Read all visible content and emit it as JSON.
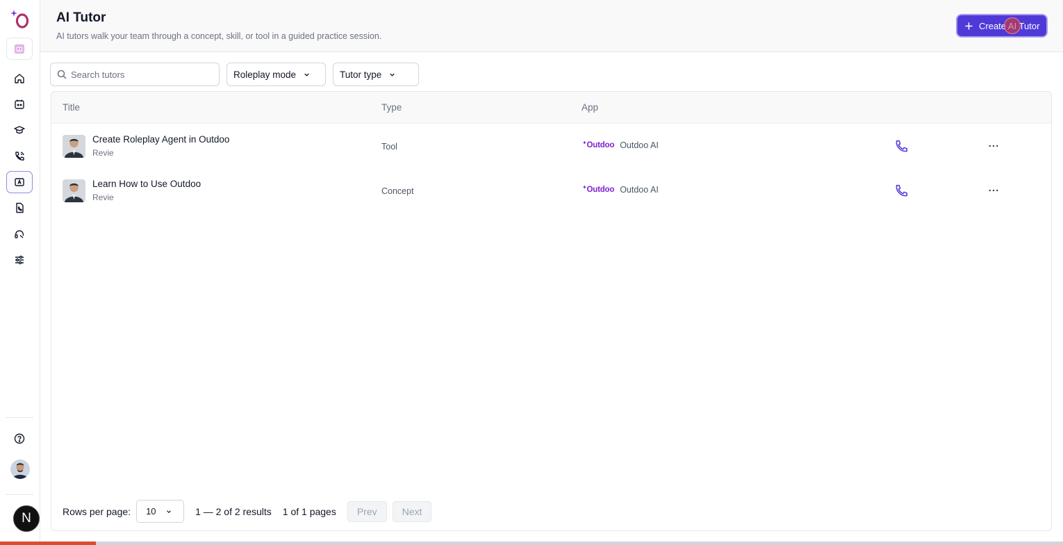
{
  "header": {
    "title": "AI Tutor",
    "subtitle": "AI tutors walk your team through a concept, skill, or tool in a guided practice session.",
    "create_button_label": "Create AI Tutor"
  },
  "sidebar": {
    "items": [
      {
        "icon": "home-icon"
      },
      {
        "icon": "calendar-bot-icon"
      },
      {
        "icon": "graduation-cap-icon"
      },
      {
        "icon": "phone-call-icon"
      },
      {
        "icon": "ai-tutor-icon",
        "active": true
      },
      {
        "icon": "document-phone-icon"
      },
      {
        "icon": "headset-icon"
      },
      {
        "icon": "sliders-icon"
      }
    ],
    "footer_badge": "N"
  },
  "filters": {
    "search_placeholder": "Search tutors",
    "roleplay_mode_label": "Roleplay mode",
    "tutor_type_label": "Tutor type"
  },
  "table": {
    "columns": [
      "Title",
      "Type",
      "App"
    ],
    "rows": [
      {
        "title": "Create Roleplay Agent in Outdoo",
        "author": "Revie",
        "type": "Tool",
        "app_logo": "Outdoo",
        "app": "Outdoo AI"
      },
      {
        "title": "Learn How to Use Outdoo",
        "author": "Revie",
        "type": "Concept",
        "app_logo": "Outdoo",
        "app": "Outdoo AI"
      }
    ]
  },
  "pagination": {
    "rows_per_page_label": "Rows per page:",
    "rows_per_page_value": "10",
    "results_text": "1 — 2 of 2 results",
    "pages_text": "1 of 1 pages",
    "prev_label": "Prev",
    "next_label": "Next"
  },
  "colors": {
    "accent": "#4f3ad8",
    "call_icon": "#5b43e0",
    "app_logo": "#7e22ce",
    "progress": "#dc4a30"
  },
  "bottom_progress_fraction": 0.09
}
